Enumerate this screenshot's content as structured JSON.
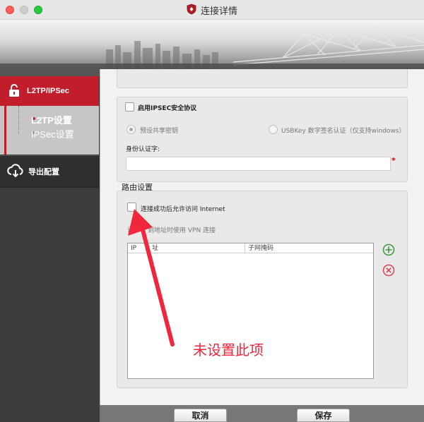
{
  "window": {
    "title": "连接详情"
  },
  "sidebar": {
    "items": [
      {
        "label": "L2TP/IPSec"
      },
      {
        "label": "导出配置"
      }
    ],
    "subitems": [
      {
        "label": "L2TP设置"
      },
      {
        "label": "IPSec设置"
      }
    ]
  },
  "ipsec": {
    "enable_label": "启用IPSEC安全协议",
    "preshared_label": "预设共享密钥",
    "usbkey_label": "USBKey 数字签名认证（仅支持windows）",
    "identity_label": "身份认证字:",
    "identity_value": "",
    "required_mark": "*"
  },
  "route": {
    "section_title": "路由设置",
    "allow_internet_label": "连接成功后允许访问 Internet",
    "use_vpn_prefix": "访",
    "use_vpn_suffix": "到地址时使用 VPN 连接",
    "table": {
      "columns": [
        "IP",
        "子网掩码"
      ],
      "col1_tail": "址",
      "rows": []
    }
  },
  "annotation": {
    "text": "未设置此项",
    "color": "#f0263c"
  },
  "footer": {
    "cancel_label": "取消",
    "save_label": "保存"
  },
  "colors": {
    "accent": "#c21d2a",
    "sidebar": "#3d3d3d",
    "add": "#3a9a3a",
    "remove": "#d9434e"
  }
}
